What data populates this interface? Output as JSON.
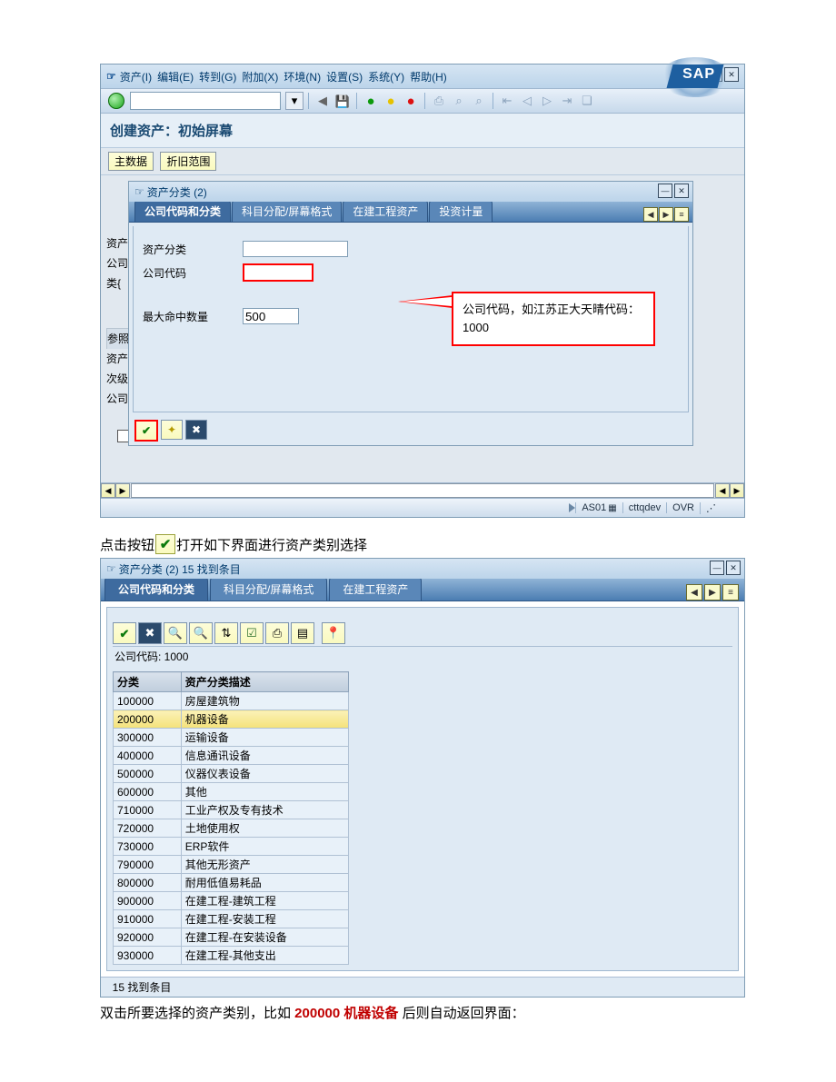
{
  "win1": {
    "menu": [
      "资产(I)",
      "编辑(E)",
      "转到(G)",
      "附加(X)",
      "环境(N)",
      "设置(S)",
      "系统(Y)",
      "帮助(H)"
    ],
    "sap": "SAP",
    "title": "创建资产：初始屏幕",
    "buttons": {
      "master": "主数据",
      "depr": "折旧范围"
    },
    "left_labels": [
      "资产",
      "公司",
      "类{",
      "",
      "参照",
      "资产",
      "次级",
      "公司"
    ],
    "modal": {
      "title_icon": "☞",
      "title": "资产分类 (2)",
      "tabs": [
        "公司代码和分类",
        "科目分配/屏幕格式",
        "在建工程资产",
        "投资计量"
      ],
      "fields": {
        "asset_class_label": "资产分类",
        "asset_class_value": "",
        "company_code_label": "公司代码",
        "company_code_value": "",
        "max_hits_label": "最大命中数量",
        "max_hits_value": "500"
      },
      "callout": "公司代码，如江苏正大天晴代码：1000",
      "ok": "✔",
      "wizard": "✦",
      "close": "✖"
    },
    "status": {
      "tcode": "AS01",
      "sys": "cttqdev",
      "mode": "OVR"
    }
  },
  "midtext": {
    "pre": "点击按钮",
    "post": "打开如下界面进行资产类别选择",
    "icon": "✔"
  },
  "win2": {
    "title_icon": "☞",
    "title": "资产分类 (2)   15 找到条目",
    "tabs": [
      "公司代码和分类",
      "科目分配/屏幕格式",
      "在建工程资产"
    ],
    "company_line": "公司代码: 1000",
    "cols": {
      "a": "分类",
      "b": "资产分类描述"
    },
    "rows": [
      {
        "a": "100000",
        "b": "房屋建筑物"
      },
      {
        "a": "200000",
        "b": "机器设备",
        "sel": true
      },
      {
        "a": "300000",
        "b": "运输设备"
      },
      {
        "a": "400000",
        "b": "信息通讯设备"
      },
      {
        "a": "500000",
        "b": "仪器仪表设备"
      },
      {
        "a": "600000",
        "b": "其他"
      },
      {
        "a": "710000",
        "b": "工业产权及专有技术"
      },
      {
        "a": "720000",
        "b": "土地使用权"
      },
      {
        "a": "730000",
        "b": "ERP软件"
      },
      {
        "a": "790000",
        "b": "其他无形资产"
      },
      {
        "a": "800000",
        "b": "耐用低值易耗品"
      },
      {
        "a": "900000",
        "b": "在建工程-建筑工程"
      },
      {
        "a": "910000",
        "b": "在建工程-安装工程"
      },
      {
        "a": "920000",
        "b": "在建工程-在安装设备"
      },
      {
        "a": "930000",
        "b": "在建工程-其他支出"
      }
    ],
    "status": "15 找到条目"
  },
  "bottom": {
    "pre": "双击所要选择的资产类别，比如 ",
    "red": "200000 机器设备 ",
    "post": "后则自动返回界面："
  },
  "toolbar_glyphs": {
    "back": "◀",
    "save": "▥",
    "ball_g": "●",
    "ball_y": "●",
    "ball_r": "●",
    "print": "⎙",
    "find": "⌕",
    "page": "❐"
  },
  "list_toolbar": {
    "check": "✔",
    "x": "✖",
    "search": "⌕",
    "searchp": "⌕+",
    "sort": "⇅",
    "mark": "☑",
    "print": "⎙",
    "exp": "▤",
    "sep": "|",
    "pin": "📌"
  }
}
